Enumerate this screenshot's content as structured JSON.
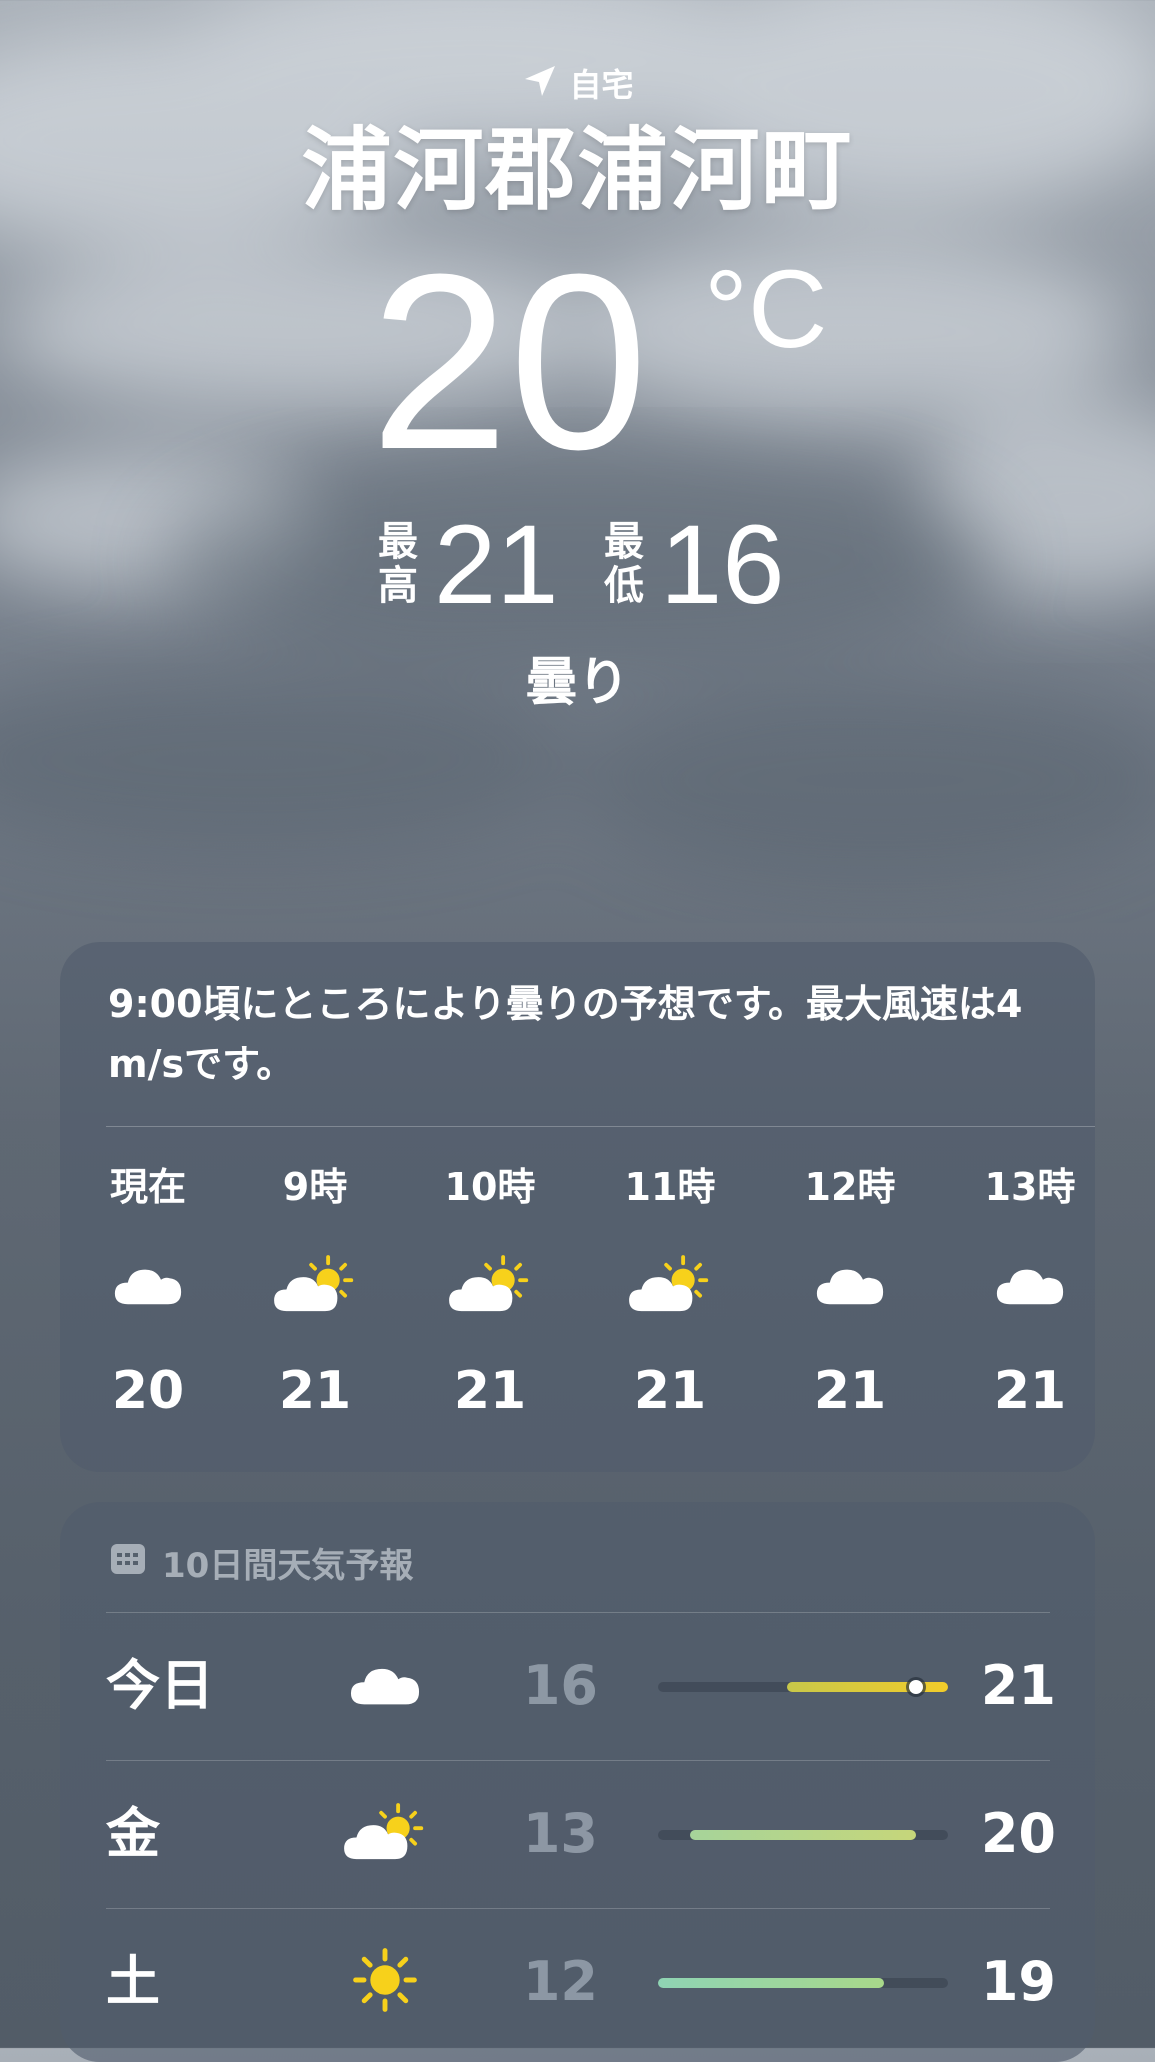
{
  "location": {
    "label": "自宅",
    "icon": "location-arrow-icon",
    "city": "浦河郡浦河町"
  },
  "current": {
    "temperature": "20",
    "unit": "°C",
    "condition": "曇り"
  },
  "high_low": {
    "high_label_1": "最",
    "high_label_2": "高",
    "high": "21",
    "low_label_1": "最",
    "low_label_2": "低",
    "low": "16"
  },
  "hourly": {
    "summary": "9:00頃にところにより曇りの予想です。最大風速は4 m/sです。",
    "items": [
      {
        "label": "現在",
        "icon": "cloud-icon",
        "temp": "20"
      },
      {
        "label": "9時",
        "icon": "partly-sunny-icon",
        "temp": "21"
      },
      {
        "label": "10時",
        "icon": "partly-sunny-icon",
        "temp": "21"
      },
      {
        "label": "11時",
        "icon": "partly-sunny-icon",
        "temp": "21"
      },
      {
        "label": "12時",
        "icon": "cloud-icon",
        "temp": "21"
      },
      {
        "label": "13時",
        "icon": "cloud-icon",
        "temp": "21"
      }
    ]
  },
  "forecast": {
    "title": "10日間天気予報",
    "icon": "calendar-icon",
    "range_min": 12,
    "range_max": 21,
    "days": [
      {
        "day": "今日",
        "icon": "cloud-icon",
        "low": "16",
        "high": "21",
        "bar_from": 16,
        "bar_to": 21,
        "current": 20,
        "color_from": "#c8c84a",
        "color_to": "#f2cc2a"
      },
      {
        "day": "金",
        "icon": "partly-sunny-icon",
        "low": "13",
        "high": "20",
        "bar_from": 13,
        "bar_to": 20,
        "color_from": "#a6d49a",
        "color_to": "#c6d67a"
      },
      {
        "day": "土",
        "icon": "sun-icon",
        "low": "12",
        "high": "19",
        "bar_from": 12,
        "bar_to": 19,
        "color_from": "#8fd4b4",
        "color_to": "#a8d88a"
      }
    ]
  },
  "colors": {
    "sun": "#f7d11b",
    "cloud": "#ffffff"
  }
}
